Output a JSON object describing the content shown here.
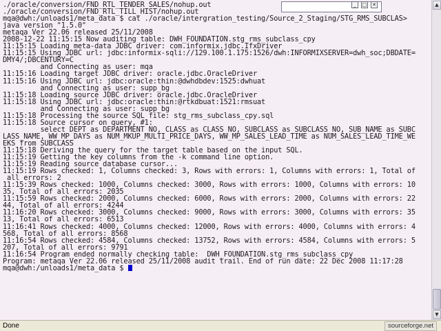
{
  "terminal": {
    "lines": [
      "./oracle/conversion/FND_RTL_TENDER_SALES/nohup.out",
      "./oracle/conversion/FND_RTL_TILL_HIST/nohup.out",
      "mqa@dwh:/unloads1/meta_data $ cat ./oracle/intergration_testing/Source_2_Staging/STG_RMS_SUBCLAS>",
      "java version \"1.5.0\"",
      "metaqa Ver 22.06 released 25/11/2008",
      "2008-12-22 11:15:15 Now auditing table: DWH_FOUNDATION.stg_rms_subclass_cpy",
      "11:15:15 Loading meta-data JDBC driver: com.informix.jdbc.IfxDriver",
      "11:15:15 Using JDBC url: jdbc:informix-sqli://129.100.1.175:1526/dwh:INFORMIXSERVER=dwh_soc;DBDATE=",
      "DMY4/;DBCENTURY=C",
      "         and Connecting as user: mqa",
      "11:15:16 Loading target JDBC driver: oracle.jdbc.OracleDriver",
      "11:15:16 Using JDBC url: jdbc:oracle:thin:@dwhdbdev:1525:dwhuat",
      "         and Connecting as user: supp_bg",
      "11:15:18 Loading source JDBC driver: oracle.jdbc.OracleDriver",
      "11:15:18 Using JDBC url: jdbc:oracle:thin:@rtkdbuat:1521:rmsuat",
      "         and Connecting as user: supp_bg",
      "11:15:18 Processing the source SQL file: stg_rms_subclass_cpy.sql",
      "11:15:18 Source cursor on query, #1:",
      "         select DEPT as DEPARTMENT_NO, CLASS as CLASS_NO, SUBCLASS as SUBCLASS_NO, SUB_NAME as SUBC",
      "LASS_NAME, WW_MP_DAYS as NUM_MKUP_MULTI_PRICE_DAYS, WW_MP_SALES_LEAD_TIME as NUM_SALES_LEAD_TIME_WE",
      "EKS from SUBCLASS",
      "11:15:18 Deriving the query for the target table based on the input SQL.",
      "11:15:19 Getting the key columns from the -k command line option.",
      "11:15:19 Reading source database cursor...",
      "11:15:19 Rows checked: 1, Columns checked: 3, Rows with errors: 1, Columns with errors: 1, Total of",
      " all errors: 2",
      "11:15:39 Rows checked: 1000, Columns checked: 3000, Rows with errors: 1000, Columns with errors: 10",
      "35, Total of all errors: 2035",
      "11:15:59 Rows checked: 2000, Columns checked: 6000, Rows with errors: 2000, Columns with errors: 22",
      "44, Total of all errors: 4244",
      "11:16:20 Rows checked: 3000, Columns checked: 9000, Rows with errors: 3000, Columns with errors: 35",
      "13, Total of all errors: 6513",
      "11:16:41 Rows checked: 4000, Columns checked: 12000, Rows with errors: 4000, Columns with errors: 4",
      "568, Total of all errors: 8568",
      "11:16:54 Rows checked: 4584, Columns checked: 13752, Rows with errors: 4584, Columns with errors: 5",
      "207, Total of all errors: 9791",
      "11:16:54 Program ended normally checking table:  DWH_FOUNDATION.stg_rms_subclass_cpy",
      "Program: metaqa Ver 22.06 released 25/11/2008 audit trail. End of run date: 22 Dec 2008 11:17:28",
      "mqa@dwh:/unloads1/meta_data $ "
    ]
  },
  "window_controls": {
    "minimize": "_",
    "maximize": "□",
    "close": "✕"
  },
  "scrollbar": {
    "up_arrow": "▲",
    "down_arrow": "▼"
  },
  "statusbar": {
    "status": "Done",
    "site": "sourceforge.net"
  },
  "colors": {
    "terminal_bg": "#f6eef5",
    "cursor": "#0000cc"
  }
}
